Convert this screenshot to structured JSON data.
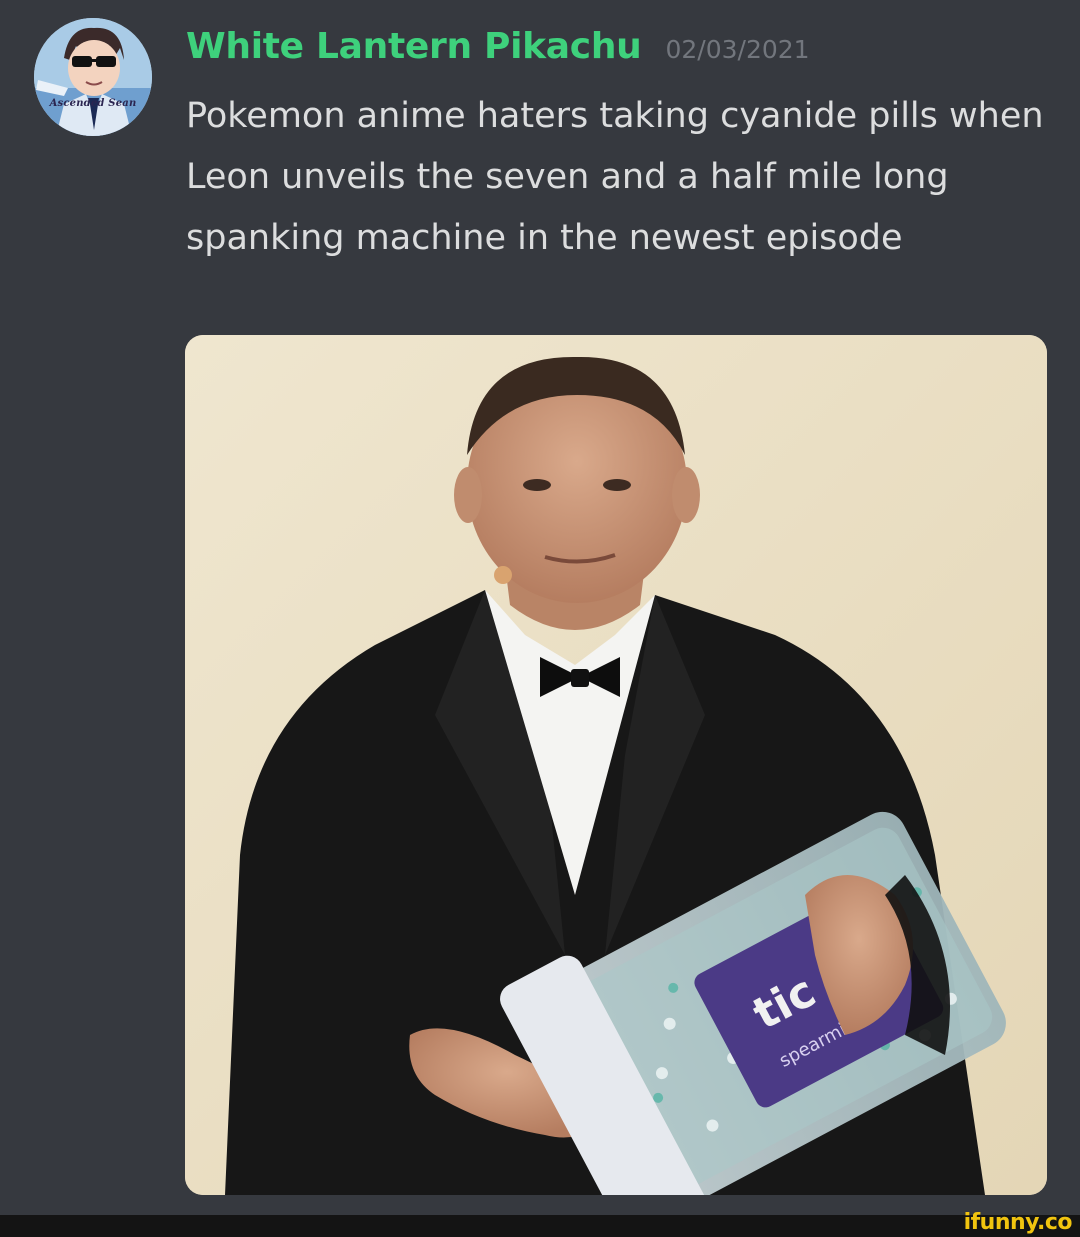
{
  "message": {
    "username": "White Lantern Pikachu",
    "timestamp": "02/03/2021",
    "text": "Pokemon anime haters taking cyanide pills when Leon unveils the seven and a half mile long spanking machine in the newest episode",
    "avatar_label": "Ascended Sean"
  },
  "embed": {
    "product_brand": "tic tac",
    "product_flavor": "spearmint"
  },
  "watermark": "ifunny.co",
  "colors": {
    "background": "#36393f",
    "username": "#3ed17c",
    "timestamp": "#72767d",
    "text": "#dcddde",
    "watermark": "#f1c40f"
  }
}
